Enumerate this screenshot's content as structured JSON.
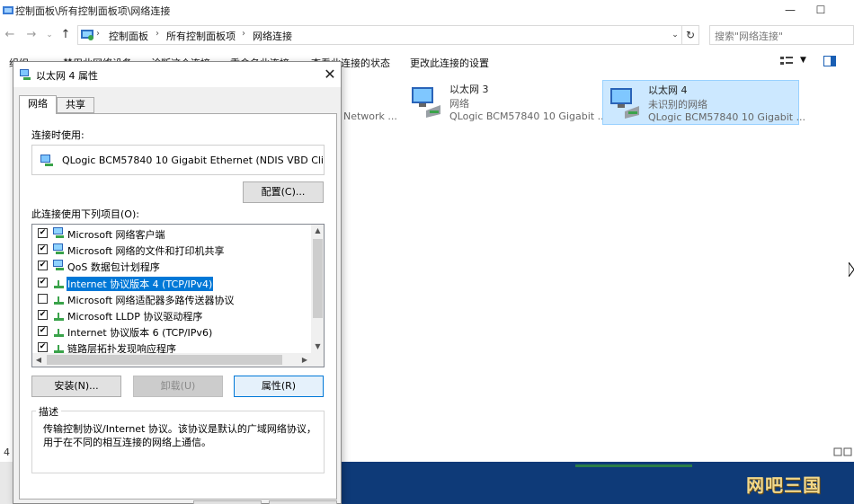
{
  "window": {
    "title": "控制面板\\所有控制面板项\\网络连接",
    "minimize_glyph": "—",
    "maximize_glyph": "☐"
  },
  "nav": {
    "back_glyph": "←",
    "forward_glyph": "→",
    "dropdown_glyph": "⌄",
    "up_glyph": "↑",
    "refresh_glyph": "↻",
    "address_dropdown_glyph": "⌄"
  },
  "address": {
    "breadcrumbs": [
      "控制面板",
      "所有控制面板项",
      "网络连接"
    ],
    "separator": "›"
  },
  "search": {
    "placeholder": "搜索\"网络连接\""
  },
  "commandbar": {
    "items": [
      "组织 ▾",
      "禁用此网络设备",
      "诊断这个连接",
      "重命名此连接",
      "查看此连接的状态",
      "更改此连接的设置"
    ]
  },
  "connections": [
    {
      "name": "以太网 3",
      "status": "网络",
      "device": "QLogic BCM57840 10 Gigabit ..."
    },
    {
      "name": "以太网 4",
      "status": "未识别的网络",
      "device": "QLogic BCM57840 10 Gigabit ..."
    }
  ],
  "partial_item_text": "Network ...",
  "status_left": "4",
  "dialog": {
    "title": "以太网 4 属性",
    "close_glyph": "✕",
    "tabs": [
      "网络",
      "共享"
    ],
    "connect_using_label": "连接时使用:",
    "adapter_name": "QLogic BCM57840 10 Gigabit Ethernet (NDIS VBD Client)",
    "configure_button": "配置(C)...",
    "items_label": "此连接使用下列项目(O):",
    "items": [
      {
        "label": "Microsoft 网络客户端",
        "checked": true,
        "icon": "network-client-icon"
      },
      {
        "label": "Microsoft 网络的文件和打印机共享",
        "checked": true,
        "icon": "file-printer-sharing-icon"
      },
      {
        "label": "QoS 数据包计划程序",
        "checked": true,
        "icon": "qos-icon"
      },
      {
        "label": "Internet 协议版本 4 (TCP/IPv4)",
        "checked": true,
        "icon": "protocol-icon"
      },
      {
        "label": "Microsoft 网络适配器多路传送器协议",
        "checked": false,
        "icon": "protocol-icon"
      },
      {
        "label": "Microsoft LLDP 协议驱动程序",
        "checked": true,
        "icon": "protocol-icon"
      },
      {
        "label": "Internet 协议版本 6 (TCP/IPv6)",
        "checked": true,
        "icon": "protocol-icon"
      },
      {
        "label": "链路层拓扑发现响应程序",
        "checked": true,
        "icon": "protocol-icon"
      }
    ],
    "checkmark": "✔",
    "install_button": "安装(N)...",
    "uninstall_button": "卸载(U)",
    "properties_button": "属性(R)",
    "description_label": "描述",
    "description_text": "传输控制协议/Internet 协议。该协议是默认的广域网络协议，用于在不同的相互连接的网络上通信。"
  },
  "watermark": "网吧三国",
  "colors": {
    "selection": "#0078d7",
    "taskbar": "#0e3a78",
    "watermark": "#f2d88a"
  }
}
